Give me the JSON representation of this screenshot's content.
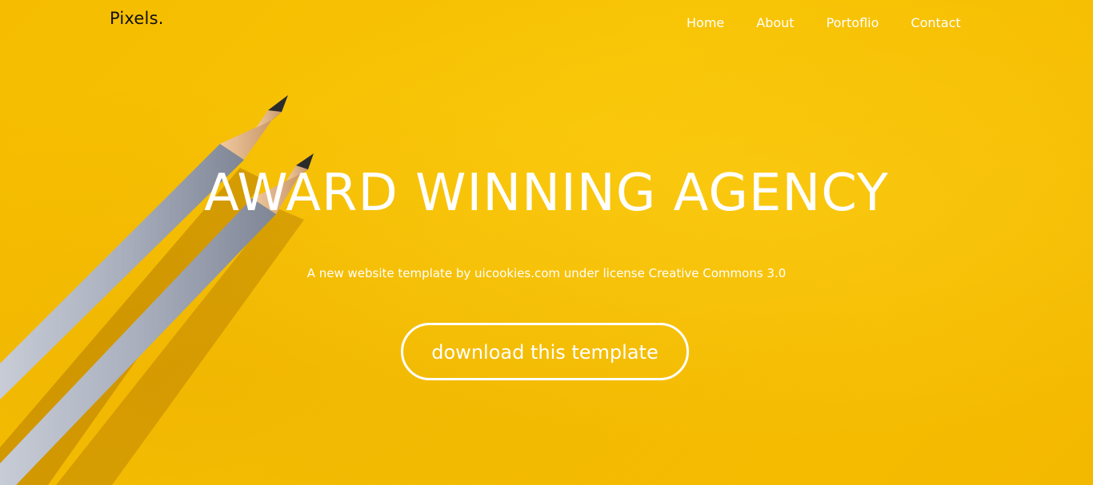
{
  "brand": {
    "name": "Pixels."
  },
  "nav": {
    "items": [
      {
        "label": "Home"
      },
      {
        "label": "About"
      },
      {
        "label": "Portoflio"
      },
      {
        "label": "Contact"
      }
    ]
  },
  "hero": {
    "headline": "AWARD WINNING AGENCY",
    "subline": "A new website template by uicookies.com under license Creative Commons 3.0",
    "cta_label": "download this template",
    "image_icon": "pencils-icon"
  },
  "colors": {
    "background": "#f8c303",
    "text": "#ffffff",
    "brand_text": "#111111",
    "pencil_body": "#aab0bd",
    "pencil_wood": "#e2b48a"
  }
}
